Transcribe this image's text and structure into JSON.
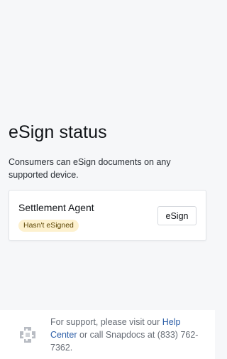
{
  "main": {
    "title": "eSign status",
    "description": "Consumers can eSign documents on any supported device."
  },
  "card": {
    "name": "Settlement Agent",
    "status_badge": "Hasn't eSigned",
    "button_label": "eSign"
  },
  "footer": {
    "logo_icon": "snapdocs-logo-icon",
    "text_before_link": "For support, please visit our ",
    "link_text": "Help Center",
    "text_after_link": " or call Snapdocs at (833) 762-7362."
  },
  "colors": {
    "background": "#f6f7f9",
    "badge_background": "#fdf1cf",
    "link": "#2d5fa8"
  }
}
